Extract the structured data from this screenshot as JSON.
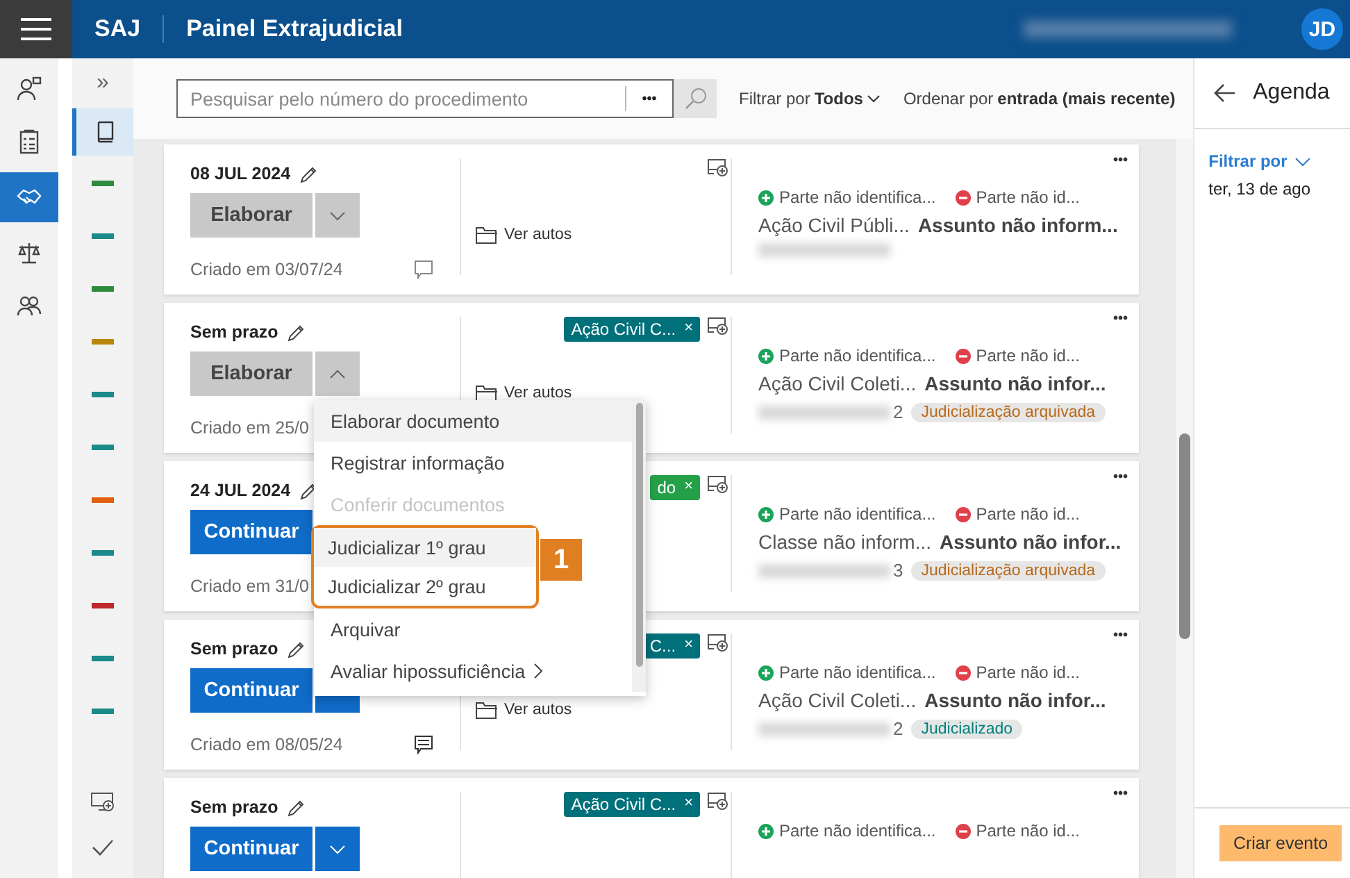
{
  "header": {
    "brand": "SAJ",
    "title": "Painel Extrajudicial",
    "avatar": "JD"
  },
  "rail": [
    {
      "kind": "person",
      "selected": false
    },
    {
      "kind": "checklist",
      "selected": false
    },
    {
      "kind": "handshake",
      "selected": true
    },
    {
      "kind": "scales",
      "selected": false
    },
    {
      "kind": "people",
      "selected": false
    }
  ],
  "side_column": {
    "expand": "»",
    "markers": [
      {
        "color": "#2e8b3e"
      },
      {
        "color": "#1a8a8a"
      },
      {
        "color": "#2e8b3e"
      },
      {
        "color": "#b8860b"
      },
      {
        "color": "#1a8a8a"
      },
      {
        "color": "#1a8a8a"
      },
      {
        "color": "#e06010"
      },
      {
        "color": "#1a8a8a"
      },
      {
        "color": "#c0282d"
      },
      {
        "color": "#1a8a8a"
      },
      {
        "color": "#1a8a8a"
      }
    ]
  },
  "toolbar": {
    "search": {
      "placeholder": "Pesquisar pelo número do procedimento",
      "more": "•••"
    },
    "filter": {
      "label": "Filtrar por",
      "value": "Todos"
    },
    "sort": {
      "label": "Ordenar por",
      "value": "entrada (mais recente)"
    }
  },
  "cards": [
    {
      "deadline": "08 JUL 2024",
      "action": {
        "label": "Elaborar",
        "kind": "secondary",
        "expanded": false
      },
      "created": "Criado em 03/07/24",
      "comments": false,
      "files_link": "Ver autos",
      "more": "•••",
      "parties": {
        "active": "Parte não identifica...",
        "passive": "Parte não id..."
      },
      "class": "Ação Civil Públi...",
      "subject": "Assunto não inform..."
    },
    {
      "deadline": "Sem prazo",
      "action": {
        "label": "Elaborar",
        "kind": "secondary",
        "expanded": true
      },
      "created": "Criado em 25/0",
      "tag": {
        "text": "Ação Civil C...",
        "close": "×",
        "color": "#00707a"
      },
      "files_link": "Ver autos",
      "more": "•••",
      "parties": {
        "active": "Parte não identifica...",
        "passive": "Parte não id..."
      },
      "class": "Ação Civil Coleti...",
      "subject": "Assunto não infor...",
      "number_tail": "2",
      "status": {
        "text": "Judicialização arquivada",
        "kind": "archived"
      }
    },
    {
      "deadline": "24 JUL 2024",
      "action": {
        "label": "Continuar",
        "kind": "primary"
      },
      "created": "Criado em 31/0",
      "tag": {
        "text": "do",
        "close": "×",
        "color": "#24a148"
      },
      "more": "•••",
      "parties": {
        "active": "Parte não identifica...",
        "passive": "Parte não id..."
      },
      "class": "Classe não inform...",
      "subject": "Assunto não infor...",
      "number_tail": "3",
      "status": {
        "text": "Judicialização arquivada",
        "kind": "archived"
      }
    },
    {
      "deadline": "Sem prazo",
      "action": {
        "label": "Continuar",
        "kind": "primary"
      },
      "created": "Criado em 08/05/24",
      "comments": true,
      "tag": {
        "text": "C...",
        "close": "×",
        "color": "#00707a"
      },
      "files_link": "Ver autos",
      "more": "•••",
      "parties": {
        "active": "Parte não identifica...",
        "passive": "Parte não id..."
      },
      "class": "Ação Civil Coleti...",
      "subject": "Assunto não infor...",
      "number_tail": "2",
      "status": {
        "text": "Judicializado",
        "kind": "judicialized"
      }
    },
    {
      "deadline": "Sem prazo",
      "action": {
        "label": "Continuar",
        "kind": "primary",
        "expanded": false
      },
      "tag": {
        "text": "Ação Civil C...",
        "close": "×",
        "color": "#00707a"
      },
      "more": "•••",
      "parties": {
        "active": "Parte não identifica...",
        "passive": "Parte não id..."
      }
    }
  ],
  "menu": {
    "callout_number": "1",
    "items": [
      {
        "label": "Elaborar documento",
        "disabled": false,
        "highlighted": true,
        "callout": false
      },
      {
        "label": "Registrar informação",
        "disabled": false,
        "highlighted": false,
        "callout": false
      },
      {
        "label": "Conferir documentos",
        "disabled": true,
        "highlighted": false,
        "callout": false
      },
      {
        "label": "Judicializar 1º grau",
        "disabled": false,
        "highlighted": true,
        "callout": true
      },
      {
        "label": "Judicializar 2º grau",
        "disabled": false,
        "highlighted": false,
        "callout": true
      },
      {
        "label": "Arquivar",
        "disabled": false,
        "highlighted": false,
        "callout": false
      },
      {
        "label": "Avaliar hipossuficiência",
        "disabled": false,
        "highlighted": false,
        "callout": false,
        "submenu": true
      }
    ]
  },
  "agenda": {
    "title": "Agenda",
    "filter": "Filtrar por",
    "date": "ter, 13 de ago",
    "create": "Criar evento"
  }
}
